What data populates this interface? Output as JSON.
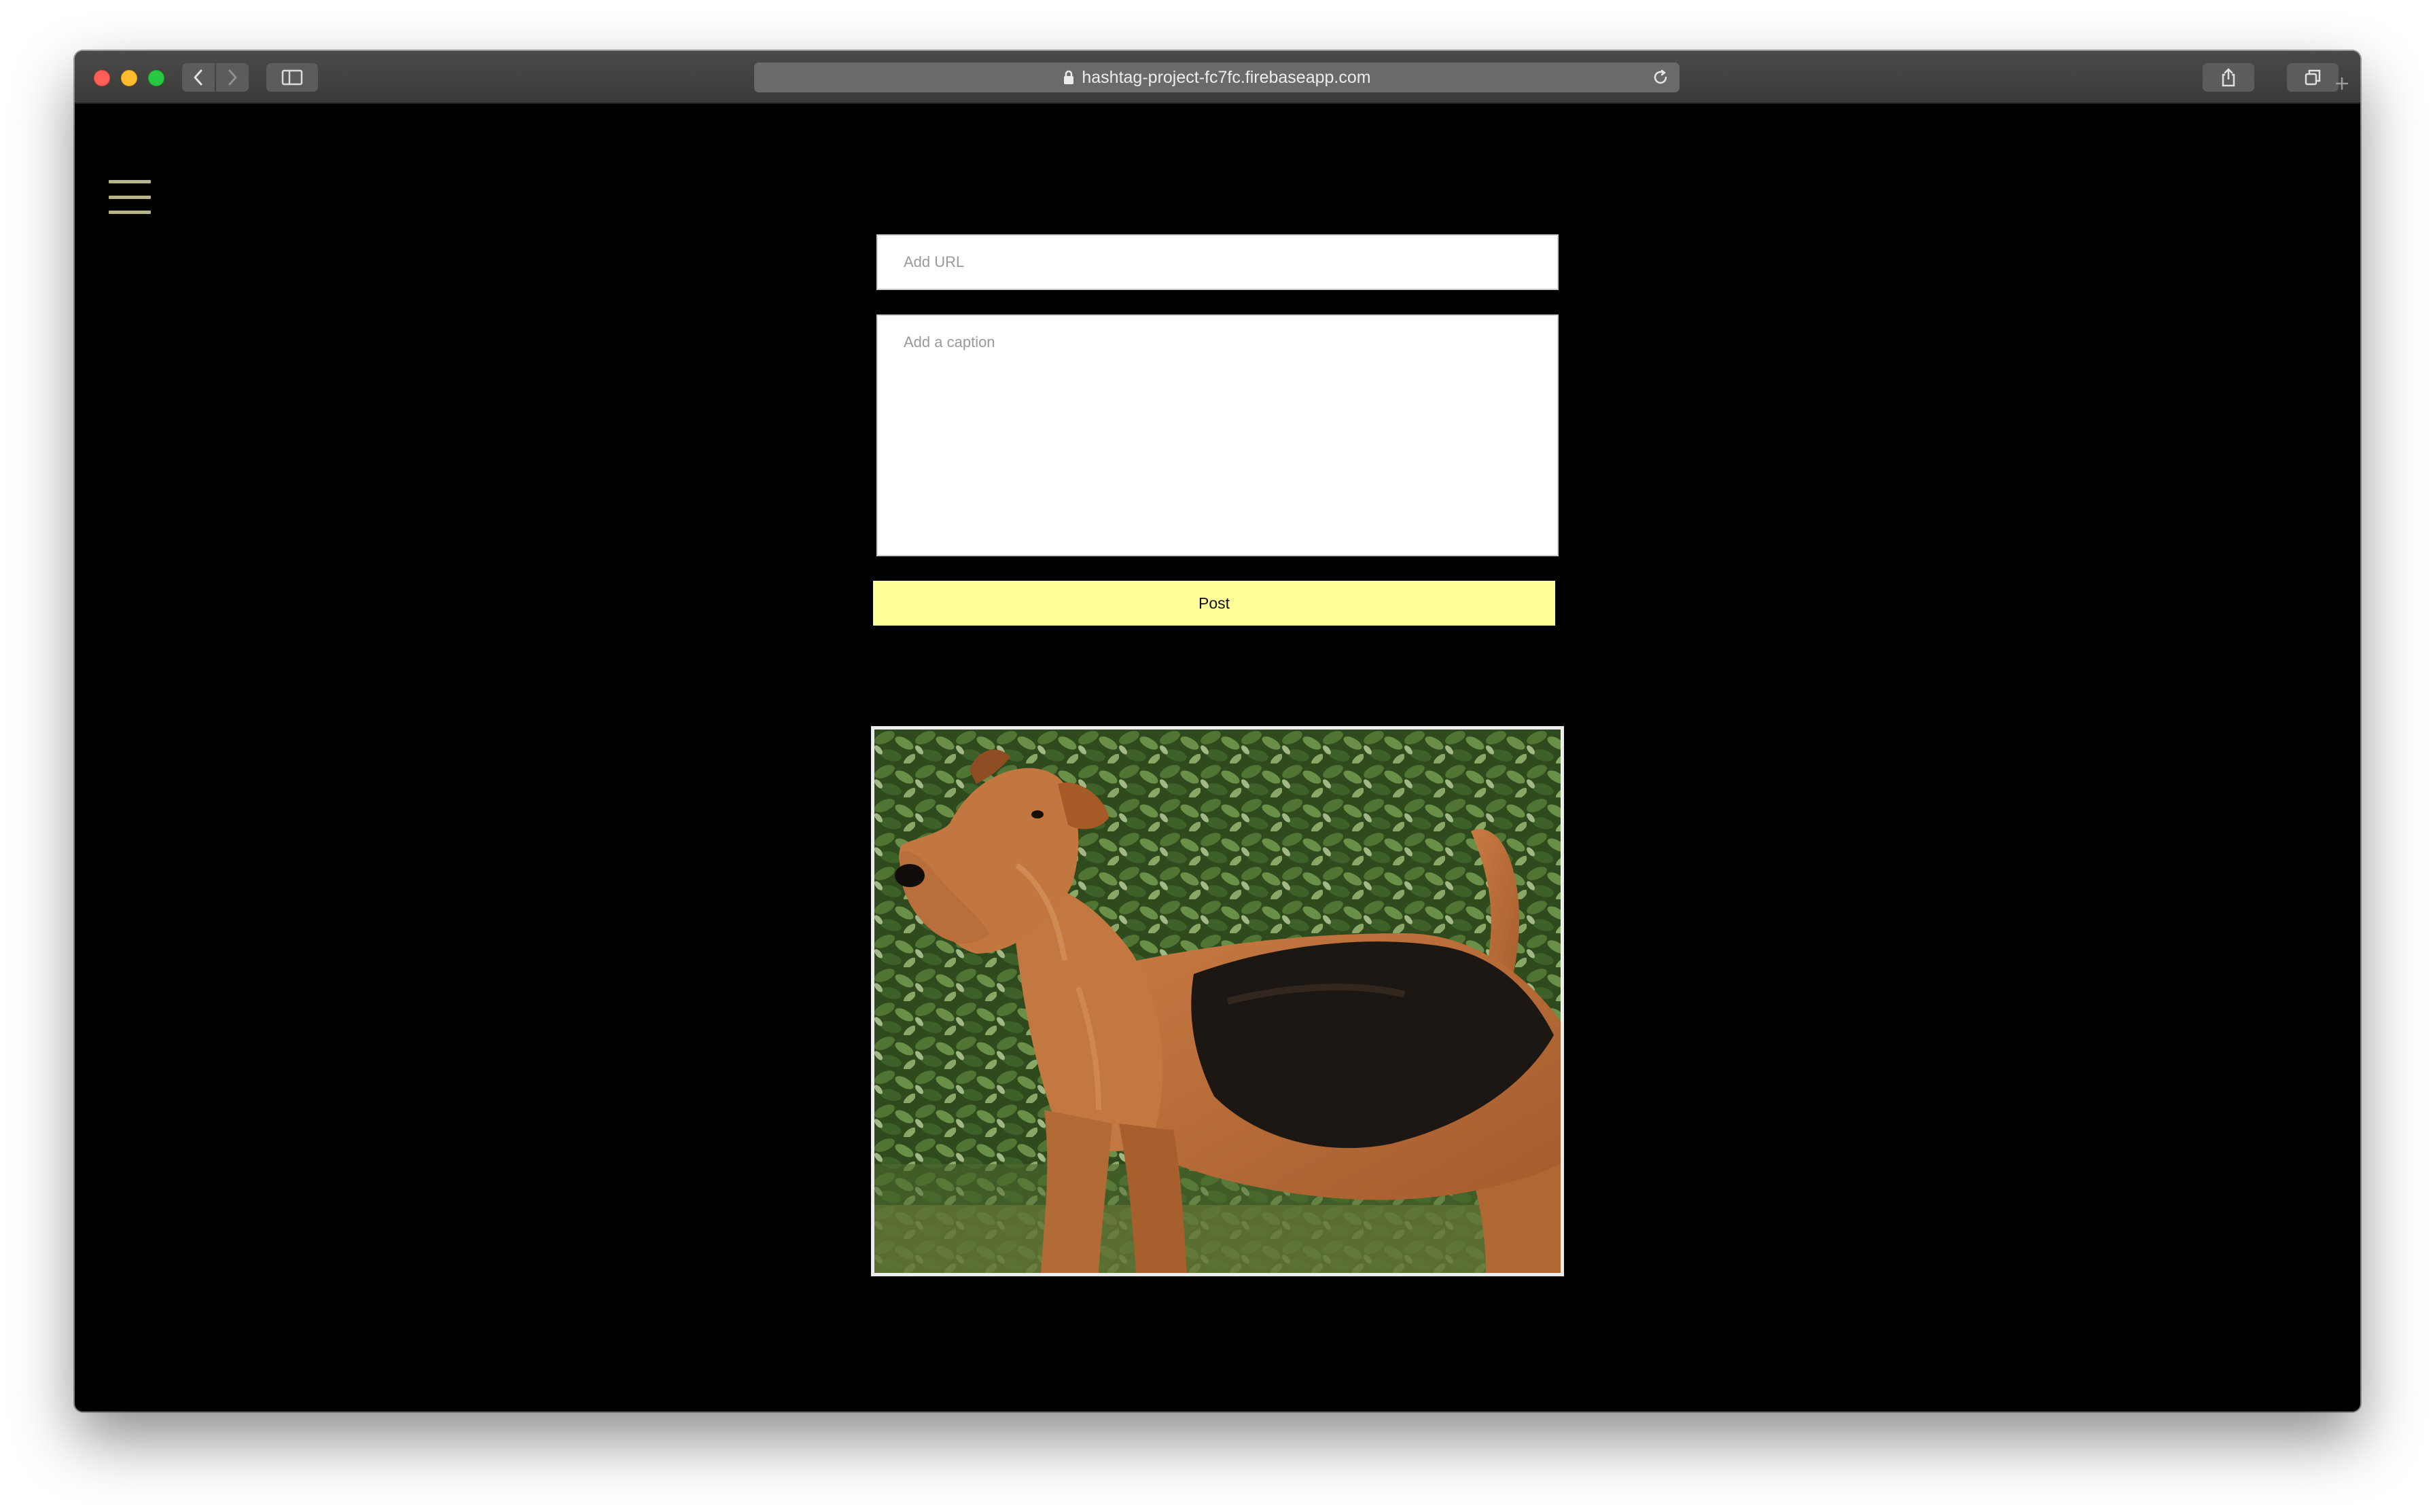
{
  "browser": {
    "url": "hashtag-project-fc7fc.firebaseapp.com",
    "icons": {
      "back": "chevron-left-icon",
      "forward": "chevron-right-icon",
      "sidebar": "sidebar-icon",
      "lock": "lock-icon",
      "reload": "reload-icon",
      "share": "share-icon",
      "tabs": "tabs-overview-icon",
      "new_tab": "plus-icon"
    }
  },
  "page": {
    "menu_icon": "hamburger-menu-icon",
    "menu_color": "#b6b48a",
    "background": "#000000",
    "url_field": {
      "placeholder": "Add URL",
      "value": ""
    },
    "caption_field": {
      "placeholder": "Add a caption",
      "value": ""
    },
    "post_button": {
      "label": "Post",
      "color": "#ffff99"
    },
    "post": {
      "image": "photo-of-airedale-terrier-in-front-of-green-hedge"
    }
  }
}
